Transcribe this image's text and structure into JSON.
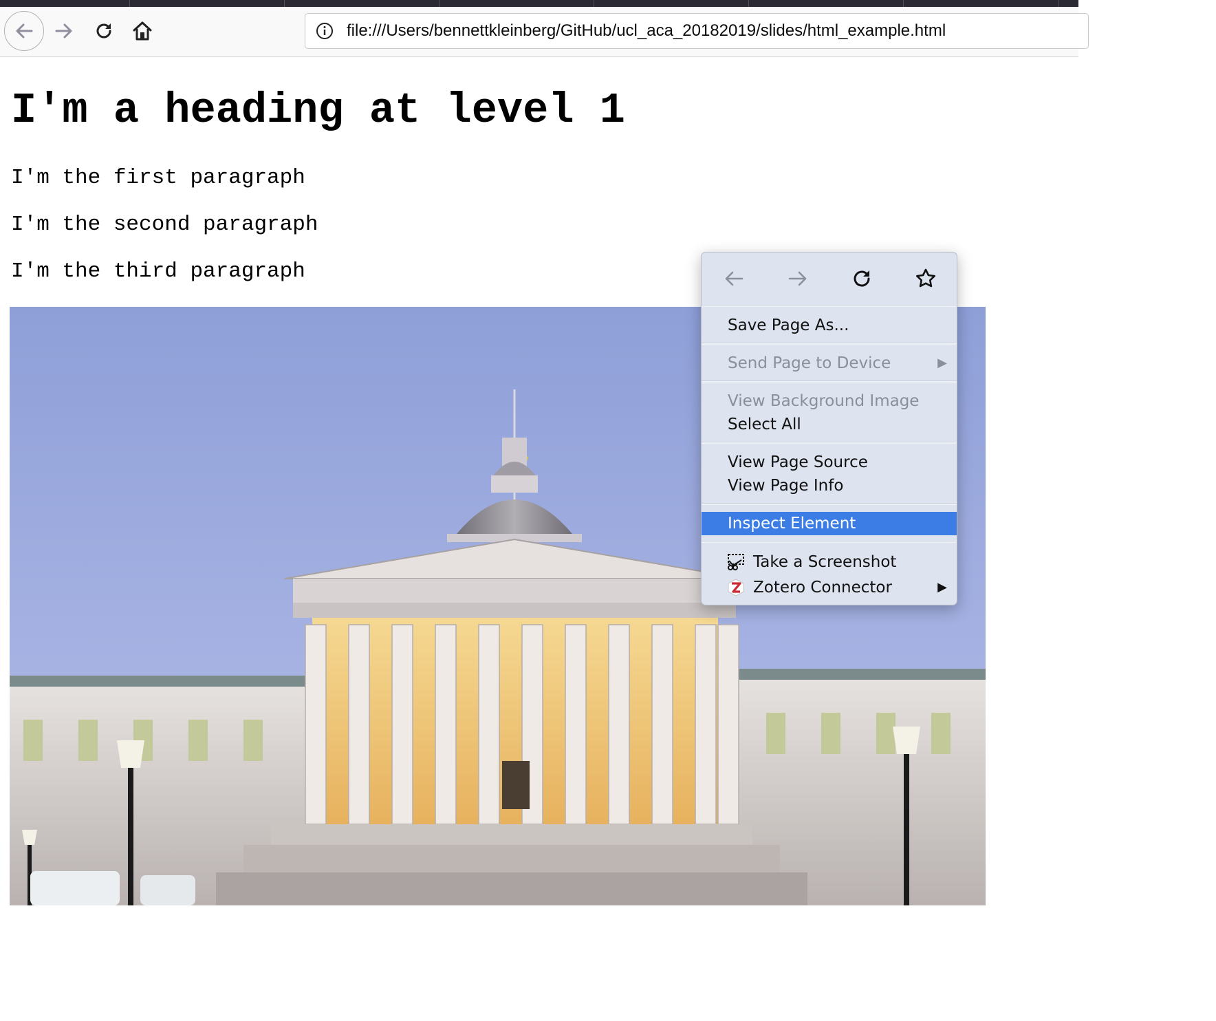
{
  "browser": {
    "url": "file:///Users/bennettkleinberg/GitHub/ucl_aca_20182019/slides/html_example.html"
  },
  "page": {
    "heading": "I'm a heading at level 1",
    "paragraphs": [
      "I'm the first paragraph",
      "I'm the second paragraph",
      "I'm the third paragraph"
    ]
  },
  "context_menu": {
    "nav_icons": [
      "back-icon",
      "forward-icon",
      "reload-icon",
      "bookmark-star-icon"
    ],
    "items": {
      "save_page_as": "Save Page As...",
      "send_page_to_device": "Send Page to Device",
      "view_background_image": "View Background Image",
      "select_all": "Select All",
      "view_page_source": "View Page Source",
      "view_page_info": "View Page Info",
      "inspect_element": "Inspect Element",
      "take_screenshot": "Take a Screenshot",
      "zotero_connector": "Zotero Connector"
    },
    "submenu_arrow": "▶",
    "highlight_color": "#3b7de4"
  }
}
